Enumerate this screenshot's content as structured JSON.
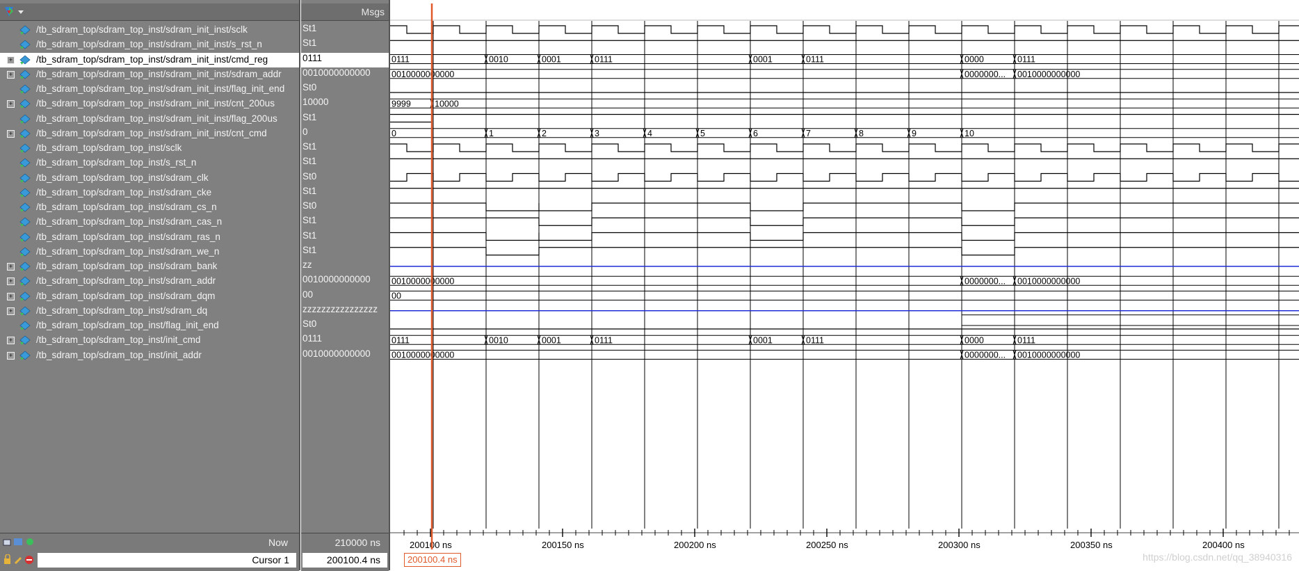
{
  "header": {
    "values_title": "Msgs"
  },
  "signals": [
    {
      "name": "/tb_sdram_top/sdram_top_inst/sdram_init_inst/sclk",
      "value": "St1",
      "kind": "bit",
      "expandable": false
    },
    {
      "name": "/tb_sdram_top/sdram_top_inst/sdram_init_inst/s_rst_n",
      "value": "St1",
      "kind": "bit",
      "expandable": false
    },
    {
      "name": "/tb_sdram_top/sdram_top_inst/sdram_init_inst/cmd_reg",
      "value": "0111",
      "kind": "bus",
      "expandable": true,
      "selected": true
    },
    {
      "name": "/tb_sdram_top/sdram_top_inst/sdram_init_inst/sdram_addr",
      "value": "0010000000000",
      "kind": "bus",
      "expandable": true
    },
    {
      "name": "/tb_sdram_top/sdram_top_inst/sdram_init_inst/flag_init_end",
      "value": "St0",
      "kind": "bit",
      "expandable": false
    },
    {
      "name": "/tb_sdram_top/sdram_top_inst/sdram_init_inst/cnt_200us",
      "value": "10000",
      "kind": "bus",
      "expandable": true
    },
    {
      "name": "/tb_sdram_top/sdram_top_inst/sdram_init_inst/flag_200us",
      "value": "St1",
      "kind": "bit",
      "expandable": false
    },
    {
      "name": "/tb_sdram_top/sdram_top_inst/sdram_init_inst/cnt_cmd",
      "value": "0",
      "kind": "bus",
      "expandable": true
    },
    {
      "name": "/tb_sdram_top/sdram_top_inst/sclk",
      "value": "St1",
      "kind": "bit",
      "expandable": false
    },
    {
      "name": "/tb_sdram_top/sdram_top_inst/s_rst_n",
      "value": "St1",
      "kind": "bit",
      "expandable": false
    },
    {
      "name": "/tb_sdram_top/sdram_top_inst/sdram_clk",
      "value": "St0",
      "kind": "bit",
      "expandable": false
    },
    {
      "name": "/tb_sdram_top/sdram_top_inst/sdram_cke",
      "value": "St1",
      "kind": "bit",
      "expandable": false
    },
    {
      "name": "/tb_sdram_top/sdram_top_inst/sdram_cs_n",
      "value": "St0",
      "kind": "bit",
      "expandable": false
    },
    {
      "name": "/tb_sdram_top/sdram_top_inst/sdram_cas_n",
      "value": "St1",
      "kind": "bit",
      "expandable": false
    },
    {
      "name": "/tb_sdram_top/sdram_top_inst/sdram_ras_n",
      "value": "St1",
      "kind": "bit",
      "expandable": false
    },
    {
      "name": "/tb_sdram_top/sdram_top_inst/sdram_we_n",
      "value": "St1",
      "kind": "bit",
      "expandable": false
    },
    {
      "name": "/tb_sdram_top/sdram_top_inst/sdram_bank",
      "value": "zz",
      "kind": "bus",
      "expandable": true
    },
    {
      "name": "/tb_sdram_top/sdram_top_inst/sdram_addr",
      "value": "0010000000000",
      "kind": "bus",
      "expandable": true
    },
    {
      "name": "/tb_sdram_top/sdram_top_inst/sdram_dqm",
      "value": "00",
      "kind": "bus",
      "expandable": true
    },
    {
      "name": "/tb_sdram_top/sdram_top_inst/sdram_dq",
      "value": "zzzzzzzzzzzzzzzz",
      "kind": "bus",
      "expandable": true
    },
    {
      "name": "/tb_sdram_top/sdram_top_inst/flag_init_end",
      "value": "St0",
      "kind": "bit",
      "expandable": false
    },
    {
      "name": "/tb_sdram_top/sdram_top_inst/init_cmd",
      "value": "0111",
      "kind": "bus",
      "expandable": true
    },
    {
      "name": "/tb_sdram_top/sdram_top_inst/init_addr",
      "value": "0010000000000",
      "kind": "bus",
      "expandable": true
    }
  ],
  "bus_labels": {
    "cmd_reg": [
      "0111",
      "0010",
      "0001",
      "0111",
      "0001",
      "0111",
      "0000",
      "0111"
    ],
    "sdram_addr": [
      "0010000000000",
      "0000000...",
      "0010000000000"
    ],
    "cnt_200us": [
      "9999",
      "10000"
    ],
    "cnt_cmd": [
      "0",
      "1",
      "2",
      "3",
      "4",
      "5",
      "6",
      "7",
      "8",
      "9",
      "10"
    ],
    "sdram_dqm": [
      "00"
    ]
  },
  "footer": {
    "now_label": "Now",
    "now_value": "210000 ns",
    "cursor_label": "Cursor 1",
    "cursor_value": "200100.4 ns",
    "cursor_marker": "200100.4 ns"
  },
  "timeline": {
    "ticks": [
      "200100 ns",
      "200150 ns",
      "200200 ns",
      "200250 ns",
      "200300 ns",
      "200350 ns",
      "200400 ns"
    ]
  },
  "watermark": "https://blog.csdn.net/qq_38940316",
  "colors": {
    "cursor": "#e0592a",
    "selected_bg": "#ffffff",
    "panel_bg": "#808080",
    "bus_z": "#1f2cd6"
  }
}
